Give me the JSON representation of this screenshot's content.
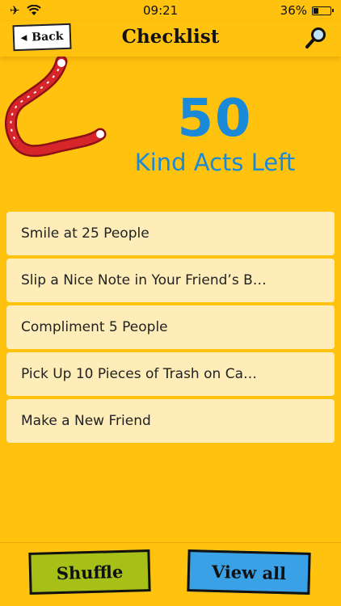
{
  "status_bar": {
    "time": "09:21",
    "battery_percent": "36%",
    "battery_level": 0.36
  },
  "nav": {
    "back_label": "Back",
    "title": "Checklist"
  },
  "hero": {
    "count": "50",
    "subtitle": "Kind Acts Left"
  },
  "checklist": {
    "items": [
      {
        "label": "Smile at 25 People"
      },
      {
        "label": "Slip a Nice Note in Your Friend’s B…"
      },
      {
        "label": "Compliment 5 People"
      },
      {
        "label": "Pick Up 10 Pieces of Trash on Ca…"
      },
      {
        "label": "Make a New Friend"
      }
    ]
  },
  "actions": {
    "shuffle_label": "Shuffle",
    "view_all_label": "View all"
  },
  "colors": {
    "background": "#FFC20E",
    "accent_blue": "#1A89D8",
    "item_bg": "#FEEDB8",
    "shuffle_green": "#A6C017",
    "view_all_blue": "#3AA1E6",
    "ribbon_red": "#D7262A"
  }
}
